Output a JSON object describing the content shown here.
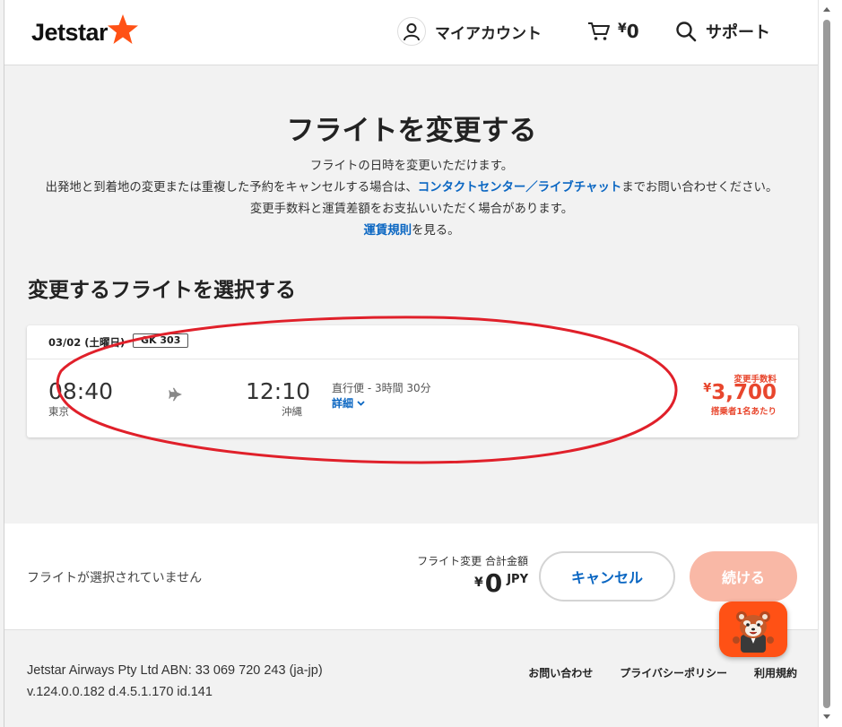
{
  "header": {
    "logo_text": "Jetstar",
    "account_label": "マイアカウント",
    "cart_currency": "¥",
    "cart_amount": "0",
    "support_label": "サポート"
  },
  "intro": {
    "title": "フライトを変更する",
    "line1": "フライトの日時を変更いただけます。",
    "line2_before": "出発地と到着地の変更または重複した予約をキャンセルする場合は、",
    "line2_link": "コンタクトセンター／ライブチャット",
    "line2_after": "までお問い合わせください。",
    "line3": "変更手数料と運賃差額をお支払いいただく場合があります。",
    "line4_link": "運賃規則",
    "line4_after": "を見る。"
  },
  "section_title": "変更するフライトを選択する",
  "flight": {
    "date": "03/02 (土曜日)",
    "flight_number": "GK 303",
    "departure_time": "08:40",
    "departure_city": "東京",
    "arrival_time": "12:10",
    "arrival_city": "沖縄",
    "duration": "直行便 - 3時間 30分",
    "details_label": "詳細",
    "fee_label": "変更手数料",
    "fee_currency": "¥",
    "fee_amount": "3,700",
    "fee_per": "搭乗者1名あたり"
  },
  "summary": {
    "status": "フライトが選択されていません",
    "total_label": "フライト変更 合計金額",
    "total_currency": "¥",
    "total_amount": "0",
    "total_currency_code": "JPY",
    "cancel_label": "キャンセル",
    "continue_label": "続ける"
  },
  "footer": {
    "company": "Jetstar Airways Pty Ltd ABN: 33 069 720 243 (ja-jp)",
    "version": "v.124.0.0.182 d.4.5.1.170 id.141",
    "links": [
      "お問い合わせ",
      "プライバシーポリシー",
      "利用規約"
    ]
  },
  "colors": {
    "brand_orange": "#ff5115",
    "fee_red": "#e8462d",
    "link_blue": "#0a66c2",
    "continue_disabled": "#f9b8a6",
    "annotation_red": "#e0202a"
  }
}
